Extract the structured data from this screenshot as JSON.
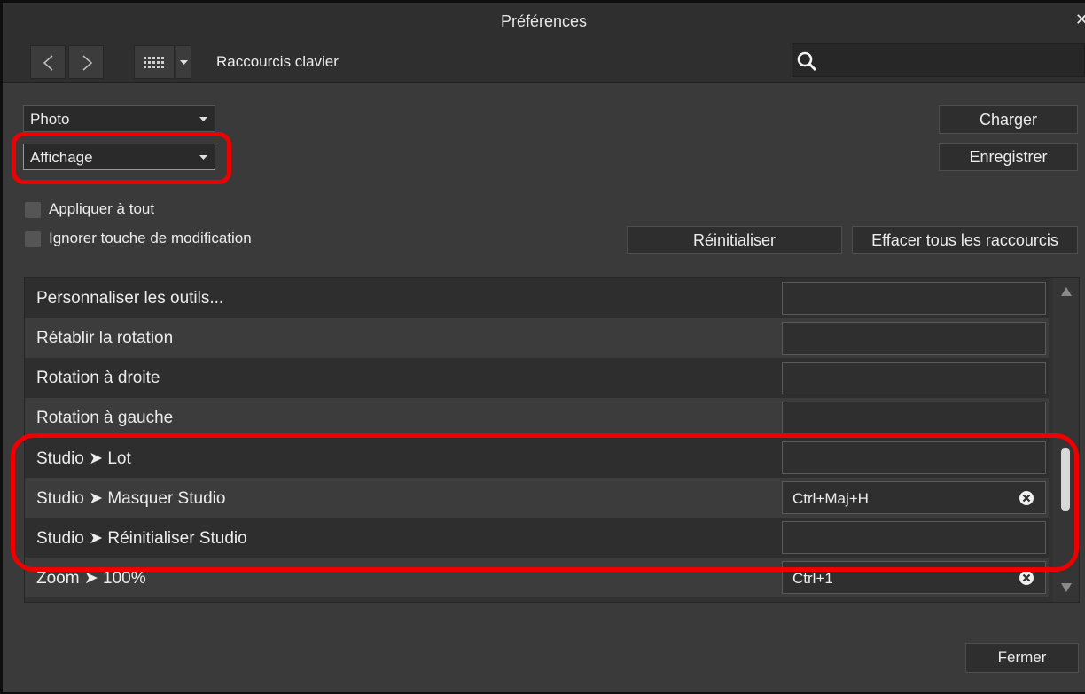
{
  "window": {
    "title": "Préférences"
  },
  "toolbar": {
    "section_label": "Raccourcis clavier",
    "search_value": ""
  },
  "controls": {
    "dropdown_app": "Photo",
    "dropdown_category": "Affichage",
    "load_label": "Charger",
    "save_label": "Enregistrer",
    "apply_all_label": "Appliquer à tout",
    "ignore_modifier_label": "Ignorer touche de modification",
    "reset_label": "Réinitialiser",
    "clear_all_label": "Effacer tous les raccourcis",
    "close_label": "Fermer"
  },
  "shortcuts": [
    {
      "name": "Personnaliser les outils...",
      "key": ""
    },
    {
      "name": "Rétablir la rotation",
      "key": ""
    },
    {
      "name": "Rotation à droite",
      "key": ""
    },
    {
      "name": "Rotation à gauche",
      "key": ""
    },
    {
      "name": "Studio ➤ Lot",
      "key": ""
    },
    {
      "name": "Studio ➤ Masquer Studio",
      "key": "Ctrl+Maj+H"
    },
    {
      "name": "Studio ➤ Réinitialiser Studio",
      "key": ""
    },
    {
      "name": "Zoom ➤ 100%",
      "key": "Ctrl+1"
    }
  ],
  "colors": {
    "highlight": "#ef0000",
    "background": "#3a3a3a",
    "titlebar": "#2f2f2f"
  },
  "icons": [
    "close-icon",
    "back-arrow-icon",
    "forward-arrow-icon",
    "grid-icon",
    "dropdown-arrow-icon",
    "search-icon",
    "clear-icon",
    "scroll-up-icon",
    "scroll-down-icon"
  ]
}
